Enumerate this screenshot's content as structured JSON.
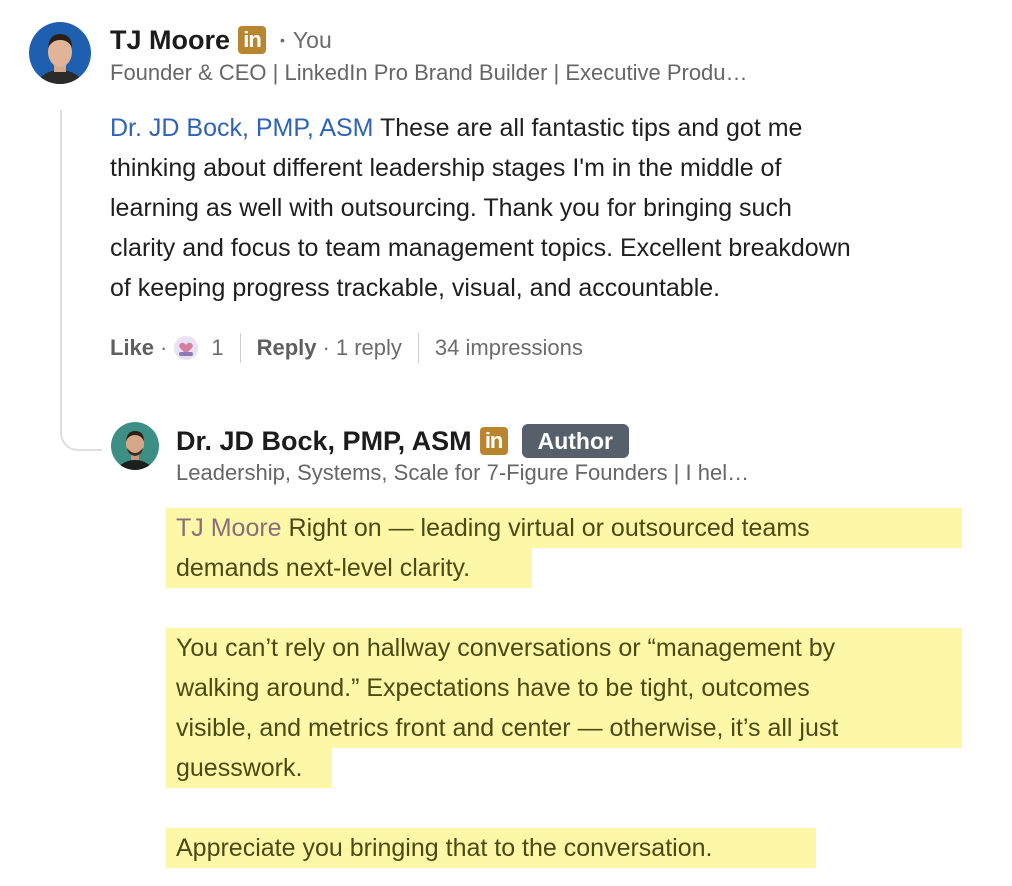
{
  "comment": {
    "author": "TJ Moore",
    "linkedin_badge": "in",
    "separator": "•",
    "you_label": "You",
    "headline": "Founder & CEO | LinkedIn Pro Brand Builder | Executive Produ…",
    "mention": "Dr. JD Bock, PMP, ASM",
    "lines": [
      " These are all fantastic tips and got me",
      "thinking about different leadership stages I'm in the middle of",
      "learning as well with outsourcing. Thank you for bringing such",
      "clarity and focus to team management topics. Excellent breakdown",
      "of keeping progress trackable, visual, and accountable."
    ],
    "actions": {
      "like": "Like",
      "dot": "·",
      "reaction_count": "1",
      "reply": "Reply",
      "reply_count": "1 reply",
      "impressions": "34 impressions"
    }
  },
  "reply": {
    "author": "Dr. JD Bock, PMP, ASM",
    "linkedin_badge": "in",
    "author_badge": "Author",
    "headline": "Leadership, Systems, Scale for 7-Figure Founders | I hel…",
    "mention": "TJ Moore",
    "p1_line1": " Right on — leading virtual or outsourced teams",
    "p1_line2": "demands next-level clarity.",
    "p2_lines": [
      "You can’t rely on hallway conversations or “management by",
      "walking around.” Expectations have to be tight, outcomes",
      "visible, and metrics front and center — otherwise, it’s all just",
      "guesswork."
    ],
    "p3": "Appreciate you bringing that to the conversation."
  },
  "colors": {
    "mention": "#2f63b8",
    "linkedin_badge": "#b9862f",
    "author_badge": "#56606b",
    "highlight": "#fdf8a8"
  }
}
